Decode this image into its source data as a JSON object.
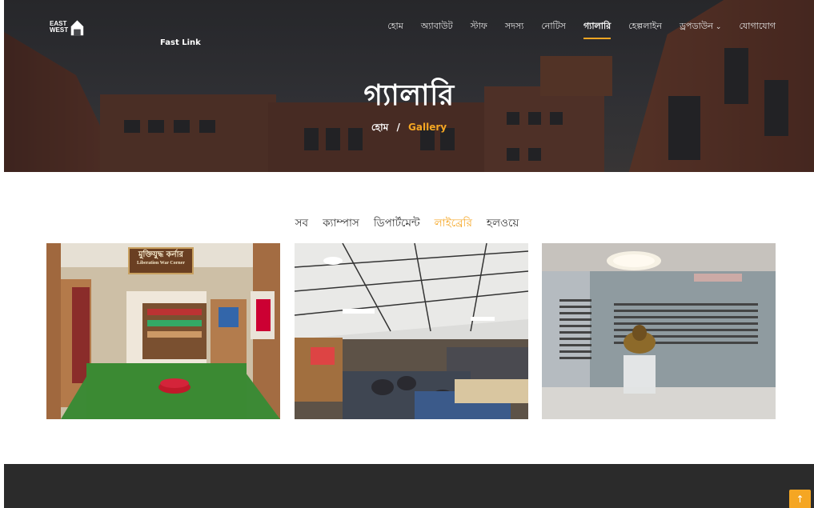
{
  "brand": {
    "logo_icon": "house-logo",
    "logo_text_line1": "EAST",
    "logo_text_line2": "WEST",
    "accent_color": "#f5a623"
  },
  "nav": {
    "items": [
      {
        "label": "হোম",
        "active": false
      },
      {
        "label": "অ্যাবাউট",
        "active": false
      },
      {
        "label": "স্টাফ",
        "active": false
      },
      {
        "label": "সদস্য",
        "active": false
      },
      {
        "label": "নোটিস",
        "active": false
      },
      {
        "label": "গ্যালারি",
        "active": true
      },
      {
        "label": "হেল্পলাইন",
        "active": false
      },
      {
        "label": "ড্রপডাউন",
        "active": false,
        "has_dropdown": true
      },
      {
        "label": "যোগাযোগ",
        "active": false
      }
    ]
  },
  "hero": {
    "title": "গ্যালারি",
    "breadcrumb_home": "হোম",
    "breadcrumb_separator": "/",
    "breadcrumb_current": "Gallery"
  },
  "filters": {
    "items": [
      "সব",
      "ক্যাম্পাস",
      "ডিপার্টমেন্ট",
      "লাইব্রেরি",
      "হলওয়ে"
    ],
    "active_index": 3
  },
  "gallery": {
    "images": [
      {
        "sign_text": "মুক্তিযুদ্ধ কর্নার",
        "sign_subtext": "Liberation War Corner"
      },
      {
        "sign_text": "",
        "sign_subtext": ""
      },
      {
        "sign_text": "",
        "sign_subtext": ""
      }
    ]
  },
  "footer": {
    "partial_text": "Fast Link"
  },
  "scroll_top": {
    "icon": "arrow-up-icon"
  }
}
